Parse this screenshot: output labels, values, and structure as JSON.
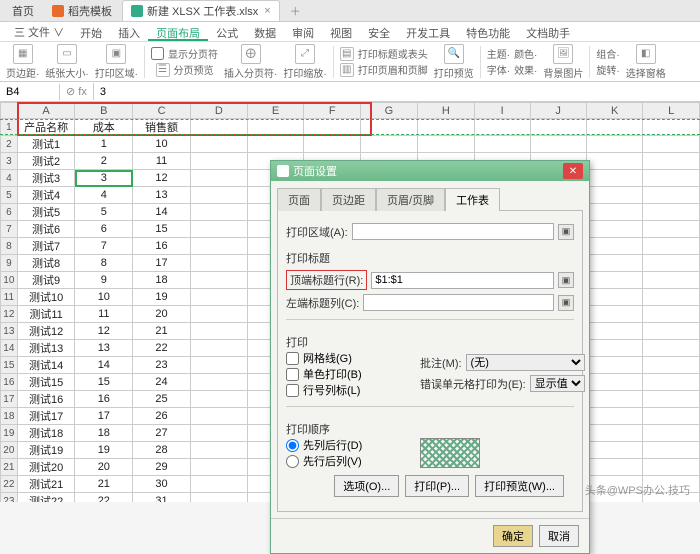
{
  "tabs": {
    "home": "首页",
    "template": "稻壳模板",
    "file": "新建 XLSX 工作表.xlsx"
  },
  "menu": {
    "file": "三 文件 ∨",
    "items": [
      "开始",
      "插入",
      "页面布局",
      "公式",
      "数据",
      "审阅",
      "视图",
      "安全",
      "开发工具",
      "特色功能",
      "文档助手"
    ],
    "active": "页面布局"
  },
  "ribbon": {
    "g1": "页边距·",
    "g2": "纸张大小·",
    "g3": "打印区域·",
    "g4a": "显示分页符",
    "g4b": "分页预览",
    "g5": "插入分页符·",
    "g6": "打印缩放·",
    "g7a": "打印标题或表头",
    "g7b": "打印页眉和页脚",
    "g8": "打印预览",
    "g9a": "主题·",
    "g9b": "颜色·",
    "g9c": "字体·",
    "g9d": "效果·",
    "g10": "背景图片",
    "g11a": "组合·",
    "g11b": "旋转·",
    "g12": "选择窗格"
  },
  "namebox": {
    "cell": "B4",
    "fx": "fx",
    "formula": "3"
  },
  "columns": [
    "A",
    "B",
    "C",
    "D",
    "E",
    "F",
    "G",
    "H",
    "I",
    "J",
    "K",
    "L"
  ],
  "header_row": [
    "产品名称",
    "成本",
    "销售额"
  ],
  "rows": [
    {
      "n": 2,
      "a": "测试1",
      "b": 1,
      "c": 10
    },
    {
      "n": 3,
      "a": "测试2",
      "b": 2,
      "c": 11
    },
    {
      "n": 4,
      "a": "测试3",
      "b": 3,
      "c": 12
    },
    {
      "n": 5,
      "a": "测试4",
      "b": 4,
      "c": 13
    },
    {
      "n": 6,
      "a": "测试5",
      "b": 5,
      "c": 14
    },
    {
      "n": 7,
      "a": "测试6",
      "b": 6,
      "c": 15
    },
    {
      "n": 8,
      "a": "测试7",
      "b": 7,
      "c": 16
    },
    {
      "n": 9,
      "a": "测试8",
      "b": 8,
      "c": 17
    },
    {
      "n": 10,
      "a": "测试9",
      "b": 9,
      "c": 18
    },
    {
      "n": 11,
      "a": "测试10",
      "b": 10,
      "c": 19
    },
    {
      "n": 12,
      "a": "测试11",
      "b": 11,
      "c": 20
    },
    {
      "n": 13,
      "a": "测试12",
      "b": 12,
      "c": 21
    },
    {
      "n": 14,
      "a": "测试13",
      "b": 13,
      "c": 22
    },
    {
      "n": 15,
      "a": "测试14",
      "b": 14,
      "c": 23
    },
    {
      "n": 16,
      "a": "测试15",
      "b": 15,
      "c": 24
    },
    {
      "n": 17,
      "a": "测试16",
      "b": 16,
      "c": 25
    },
    {
      "n": 18,
      "a": "测试17",
      "b": 17,
      "c": 26
    },
    {
      "n": 19,
      "a": "测试18",
      "b": 18,
      "c": 27
    },
    {
      "n": 20,
      "a": "测试19",
      "b": 19,
      "c": 28
    },
    {
      "n": 21,
      "a": "测试20",
      "b": 20,
      "c": 29
    },
    {
      "n": 22,
      "a": "测试21",
      "b": 21,
      "c": 30
    },
    {
      "n": 23,
      "a": "测试22",
      "b": 22,
      "c": 31
    }
  ],
  "selected_row_n": 4,
  "dialog": {
    "title": "页面设置",
    "tabs": [
      "页面",
      "页边距",
      "页眉/页脚",
      "工作表"
    ],
    "active_tab": "工作表",
    "print_area_label": "打印区域(A):",
    "print_title_section": "打印标题",
    "top_row_label": "顶端标题行(R):",
    "top_row_value": "$1:$1",
    "left_col_label": "左端标题列(C):",
    "print_section": "打印",
    "cb_gridlines": "网格线(G)",
    "cb_single": "单色打印(B)",
    "cb_rowcol": "行号列标(L)",
    "comments_label": "批注(M):",
    "comments_value": "(无)",
    "errors_label": "错误单元格打印为(E):",
    "errors_value": "显示值",
    "order_section": "打印顺序",
    "order_down": "先列后行(D)",
    "order_over": "先行后列(V)",
    "btn_options": "选项(O)...",
    "btn_print": "打印(P)...",
    "btn_preview": "打印预览(W)...",
    "btn_ok": "确定",
    "btn_cancel": "取消"
  },
  "watermark": "头条@WPS办公.技巧"
}
